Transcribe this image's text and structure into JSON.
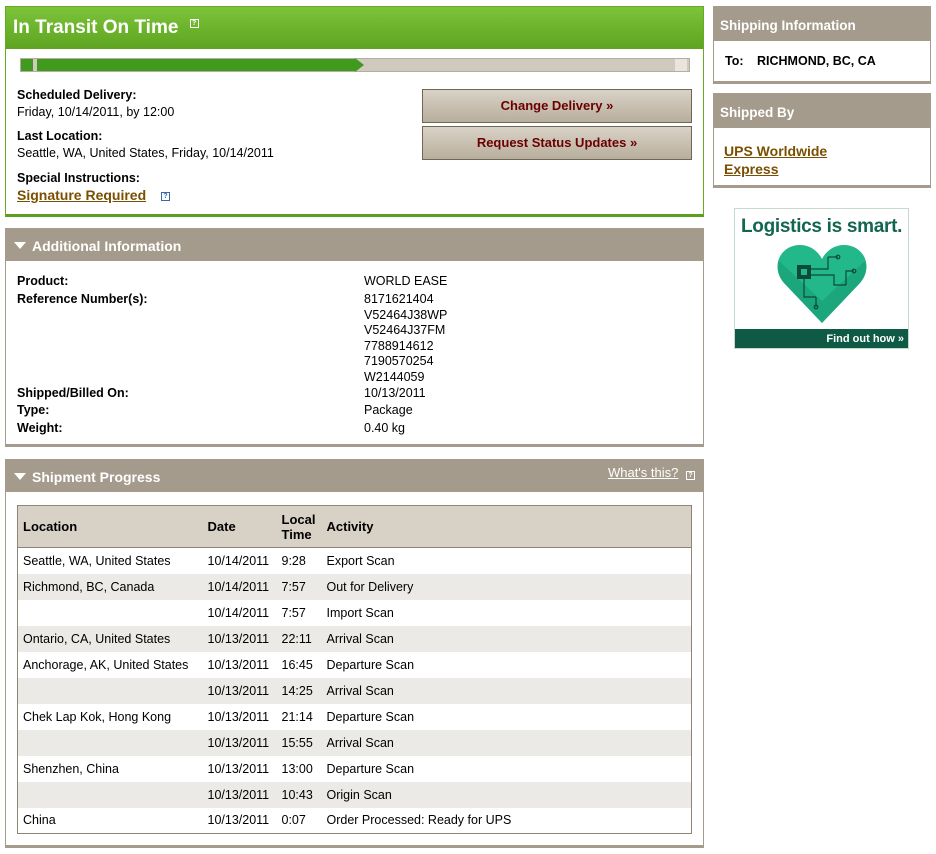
{
  "status": {
    "title": "In Transit On Time",
    "progress_fraction": 0.5,
    "scheduled_delivery_label": "Scheduled Delivery:",
    "scheduled_delivery_value": "Friday, 10/14/2011, by 12:00",
    "last_location_label": "Last Location:",
    "last_location_value": "Seattle, WA, United States, Friday, 10/14/2011",
    "special_instructions_label": "Special Instructions:",
    "signature_link": "Signature Required",
    "change_delivery_button": "Change Delivery »",
    "request_updates_button": "Request Status Updates »"
  },
  "additional_info": {
    "title": "Additional Information",
    "product_label": "Product:",
    "product_value": "WORLD EASE",
    "reference_label": "Reference Number(s):",
    "references": [
      "8171621404",
      "V52464J38WP",
      "V52464J37FM",
      "7788914612",
      "7190570254",
      "W2144059"
    ],
    "shipped_label": "Shipped/Billed On:",
    "shipped_value": "10/13/2011",
    "type_label": "Type:",
    "type_value": "Package",
    "weight_label": "Weight:",
    "weight_value": "0.40 kg"
  },
  "shipment_progress": {
    "title": "Shipment Progress",
    "whats_this": "What's this?",
    "columns": {
      "location": "Location",
      "date": "Date",
      "time_line1": "Local",
      "time_line2": "Time",
      "activity": "Activity"
    },
    "rows": [
      {
        "location": "Seattle, WA, United States",
        "date": "10/14/2011",
        "time": "9:28",
        "activity": "Export Scan"
      },
      {
        "location": "Richmond, BC, Canada",
        "date": "10/14/2011",
        "time": "7:57",
        "activity": "Out for Delivery"
      },
      {
        "location": "",
        "date": "10/14/2011",
        "time": "7:57",
        "activity": "Import Scan"
      },
      {
        "location": "Ontario, CA, United States",
        "date": "10/13/2011",
        "time": "22:11",
        "activity": "Arrival Scan"
      },
      {
        "location": "Anchorage, AK, United States",
        "date": "10/13/2011",
        "time": "16:45",
        "activity": "Departure Scan"
      },
      {
        "location": "",
        "date": "10/13/2011",
        "time": "14:25",
        "activity": "Arrival Scan"
      },
      {
        "location": "Chek Lap Kok, Hong Kong",
        "date": "10/13/2011",
        "time": "21:14",
        "activity": "Departure Scan"
      },
      {
        "location": "",
        "date": "10/13/2011",
        "time": "15:55",
        "activity": "Arrival Scan"
      },
      {
        "location": "Shenzhen, China",
        "date": "10/13/2011",
        "time": "13:00",
        "activity": "Departure Scan"
      },
      {
        "location": "",
        "date": "10/13/2011",
        "time": "10:43",
        "activity": "Origin Scan"
      },
      {
        "location": "China",
        "date": "10/13/2011",
        "time": "0:07",
        "activity": "Order Processed: Ready for UPS"
      }
    ]
  },
  "sidebar": {
    "shipping_info_title": "Shipping Information",
    "to_label": "To:",
    "to_value": "RICHMOND, BC, CA",
    "shipped_by_title": "Shipped By",
    "service_link": "UPS Worldwide Express"
  },
  "ad": {
    "headline": "Logistics is smart.",
    "cta": "Find out how »"
  },
  "colors": {
    "status_green": "#5ea421",
    "progress_green": "#3f9a1e",
    "panel_taupe": "#a49b8c",
    "link_brown": "#7a4f00",
    "button_text": "#6b0000",
    "ad_green": "#0f5a44"
  }
}
